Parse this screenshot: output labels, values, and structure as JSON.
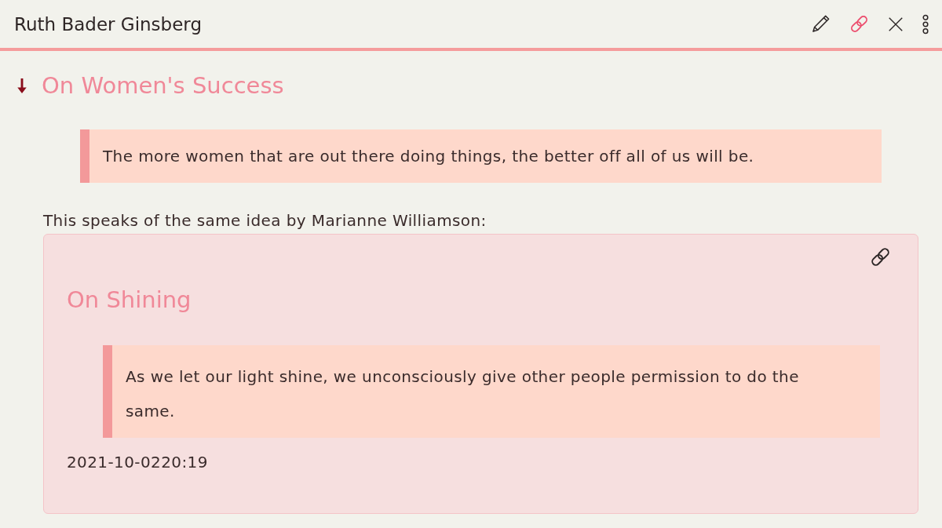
{
  "header": {
    "title": "Ruth Bader Ginsberg",
    "actions": [
      {
        "kind": "edit",
        "active": false
      },
      {
        "kind": "link",
        "active": true
      },
      {
        "kind": "close",
        "active": false
      },
      {
        "kind": "more",
        "active": false
      }
    ]
  },
  "note": {
    "heading": "On Women's Success",
    "quote": "The more women that are out there doing things, the better off all of us will be.",
    "text": "This speaks of the same idea by Marianne Williamson:"
  },
  "linked_note": {
    "heading": "On Shining",
    "quote": "As we let our light shine, we unconsciously give other people permission to do the same.",
    "timestamp": "2021-10-0220:19"
  }
}
